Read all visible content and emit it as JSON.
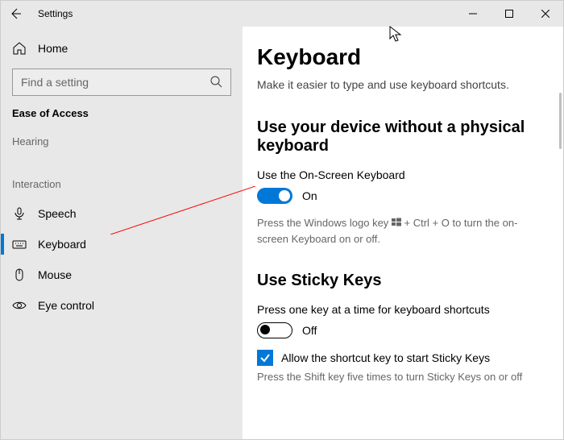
{
  "window": {
    "title": "Settings"
  },
  "sidebar": {
    "home_label": "Home",
    "search_placeholder": "Find a setting",
    "ease_of_access_label": "Ease of Access",
    "group_hearing": "Hearing",
    "group_interaction": "Interaction",
    "items": {
      "speech": "Speech",
      "keyboard": "Keyboard",
      "mouse": "Mouse",
      "eye_control": "Eye control"
    }
  },
  "page": {
    "title": "Keyboard",
    "subtitle": "Make it easier to type and use keyboard shortcuts.",
    "section1": {
      "heading": "Use your device without a physical keyboard",
      "toggle_label": "Use the On-Screen Keyboard",
      "toggle_state": "On",
      "hint_a": "Press the Windows logo key ",
      "hint_b": " + Ctrl + O to turn the on-screen Keyboard on or off."
    },
    "section2": {
      "heading": "Use Sticky Keys",
      "toggle_label": "Press one key at a time for keyboard shortcuts",
      "toggle_state": "Off",
      "checkbox_label": "Allow the shortcut key to start Sticky Keys",
      "checkbox_hint": "Press the Shift key five times to turn Sticky Keys on or off"
    }
  }
}
